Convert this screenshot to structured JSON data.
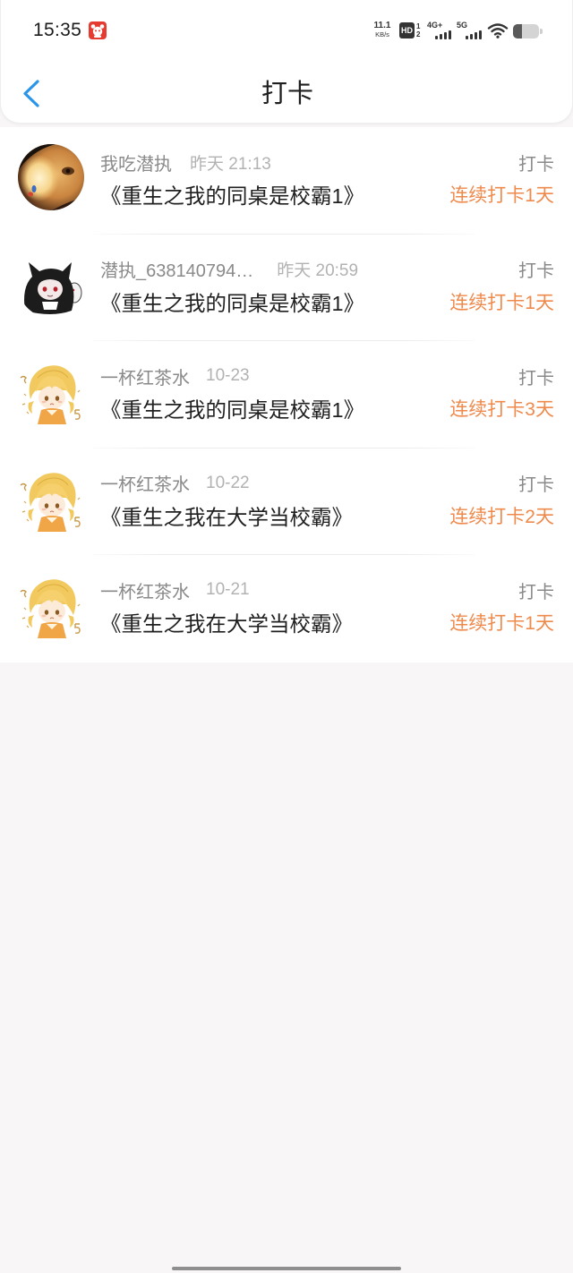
{
  "status_bar": {
    "time": "15:35",
    "network_speed": "11.1",
    "network_speed_unit": "KB/s",
    "hd_label": "HD",
    "sim_slots": [
      "1",
      "2"
    ],
    "network_1": "4G+",
    "network_2": "5G",
    "signal_1_bars": 4,
    "signal_2_bars": 4,
    "battery_level": 0.35
  },
  "header": {
    "title": "打卡",
    "back_icon": "chevron-left-icon"
  },
  "items": [
    {
      "name": "我吃潜执",
      "time": "昨天 21:13",
      "action": "打卡",
      "book": "《重生之我的同桌是校霸1》",
      "streak": "连续打卡1天"
    },
    {
      "name": "潜执_638140794…",
      "time": "昨天 20:59",
      "action": "打卡",
      "book": "《重生之我的同桌是校霸1》",
      "streak": "连续打卡1天"
    },
    {
      "name": "一杯红茶水",
      "time": "10-23",
      "action": "打卡",
      "book": "《重生之我的同桌是校霸1》",
      "streak": "连续打卡3天"
    },
    {
      "name": "一杯红茶水",
      "time": "10-22",
      "action": "打卡",
      "book": "《重生之我在大学当校霸》",
      "streak": "连续打卡2天"
    },
    {
      "name": "一杯红茶水",
      "time": "10-21",
      "action": "打卡",
      "book": "《重生之我在大学当校霸》",
      "streak": "连续打卡1天"
    }
  ],
  "colors": {
    "accent": "#2b95e8",
    "streak": "#ef8a4c",
    "background": "#f8f6f7",
    "card": "#ffffff"
  }
}
